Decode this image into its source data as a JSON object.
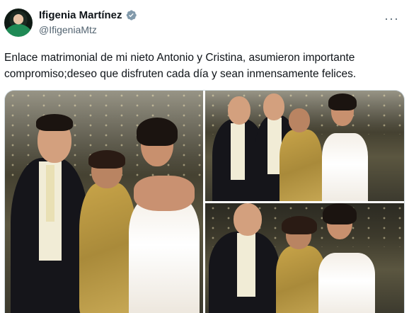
{
  "author": {
    "display_name": "Ifigenia Martínez",
    "handle": "@IfigeniaMtz",
    "verified_icon": "verified-badge-icon"
  },
  "tweet": {
    "text_line1": "Enlace matrimonial de mi nieto Antonio y Cristina, asumieron importante",
    "text_line2": "compromiso;deseo que disfruten cada día y sean inmensamente felices."
  },
  "menu": {
    "more_glyph": "···"
  },
  "colors": {
    "verified": "#1d9bf0",
    "text": "#0f1419",
    "secondary": "#536471",
    "border": "#cfd9de"
  }
}
